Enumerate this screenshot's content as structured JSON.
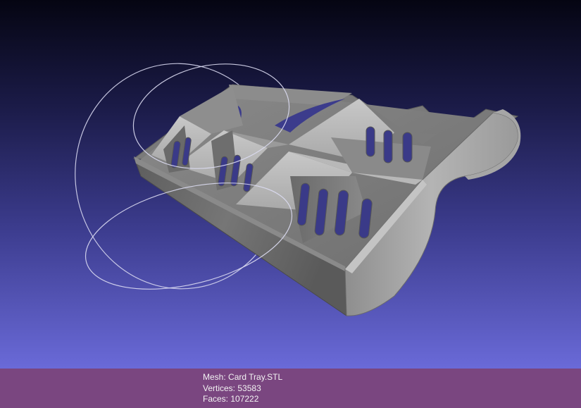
{
  "viewer": {
    "background_top": "#050512",
    "background_bottom": "#6a6ad8",
    "info_bar_color": "#7a4680",
    "trackball_color": "#d8d8f0",
    "mesh_color": "#9a9a9a"
  },
  "info": {
    "mesh_label": "Mesh:",
    "mesh_name": "Card Tray.STL",
    "vertices_label": "Vertices:",
    "vertices_value": "53583",
    "faces_label": "Faces:",
    "faces_value": "107222"
  }
}
